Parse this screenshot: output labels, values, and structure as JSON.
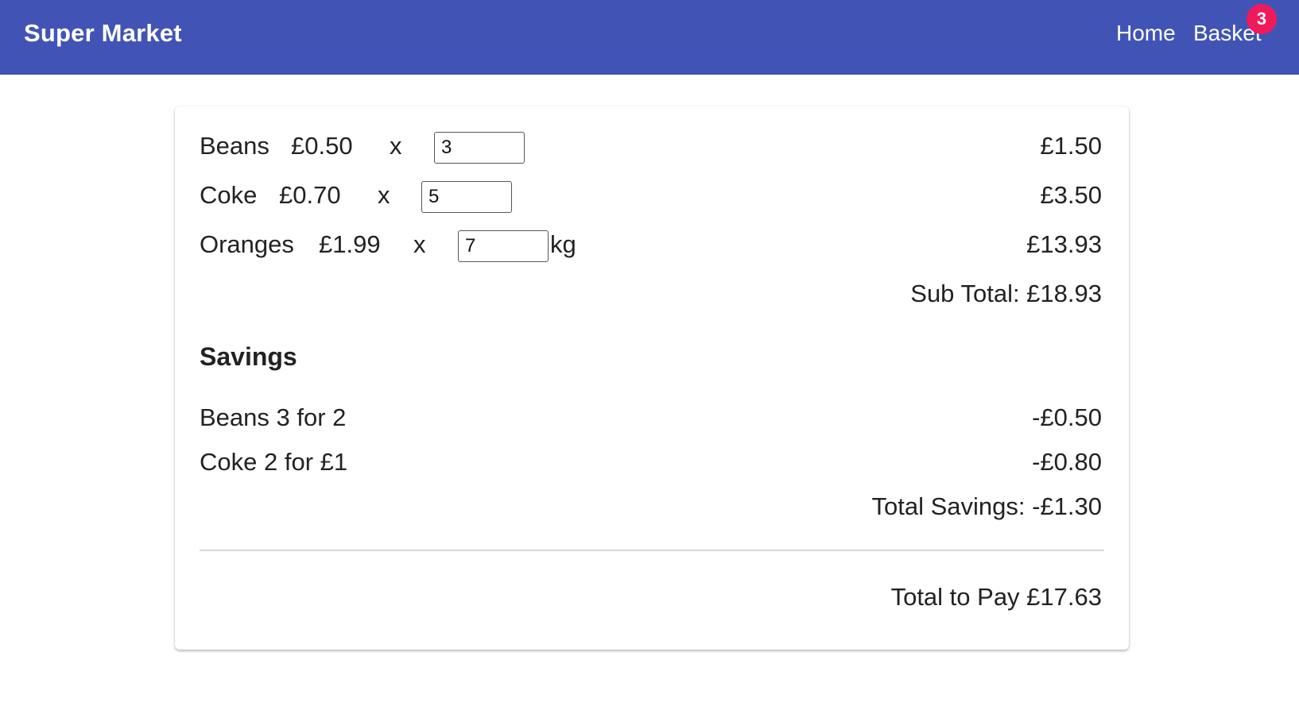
{
  "header": {
    "brand": "Super Market",
    "nav": {
      "home": "Home",
      "basket": "Basket",
      "basket_count": "3"
    },
    "accent_color": "#4154b6",
    "badge_color": "#f01a5a"
  },
  "basket": {
    "items": [
      {
        "name": "Beans",
        "price": "£0.50",
        "times": "x",
        "quantity": "3",
        "unit": "",
        "line_total": "£1.50"
      },
      {
        "name": "Coke",
        "price": "£0.70",
        "times": "x",
        "quantity": "5",
        "unit": "",
        "line_total": "£3.50"
      },
      {
        "name": "Oranges",
        "price": "£1.99",
        "times": "x",
        "quantity": "7",
        "unit": "kg",
        "line_total": "£13.93"
      }
    ],
    "sub_total": "Sub Total: £18.93",
    "savings_heading": "Savings",
    "savings": [
      {
        "label": "Beans 3 for 2",
        "amount": "-£0.50"
      },
      {
        "label": "Coke 2 for £1",
        "amount": "-£0.80"
      }
    ],
    "total_savings": "Total Savings: -£1.30",
    "total_to_pay": "Total to Pay £17.63"
  }
}
